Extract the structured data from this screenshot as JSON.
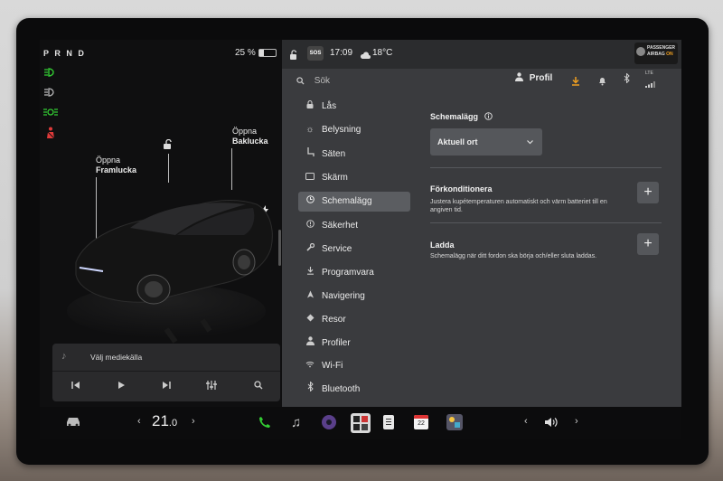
{
  "left_panel": {
    "gear": "P R N D",
    "battery_pct": "25 %",
    "frunk_label_1": "Öppna",
    "frunk_label_2": "Framlucka",
    "trunk_label_1": "Öppna",
    "trunk_label_2": "Baklucka",
    "media_source": "Välj mediekälla"
  },
  "top_bar": {
    "sos": "SOS",
    "time": "17:09",
    "temperature": "18°C",
    "passenger_airbag_1": "PASSENGER",
    "passenger_airbag_2": "AIRBAG",
    "passenger_airbag_state": "ON"
  },
  "search": {
    "placeholder": "Sök"
  },
  "header": {
    "profile": "Profil",
    "lte": "LTE"
  },
  "menu": {
    "items": [
      {
        "label": "Lås",
        "icon": "lock-icon"
      },
      {
        "label": "Belysning",
        "icon": "sun-icon"
      },
      {
        "label": "Säten",
        "icon": "seat-icon"
      },
      {
        "label": "Skärm",
        "icon": "display-icon"
      },
      {
        "label": "Schemalägg",
        "icon": "clock-icon"
      },
      {
        "label": "Säkerhet",
        "icon": "info-icon"
      },
      {
        "label": "Service",
        "icon": "wrench-icon"
      },
      {
        "label": "Programvara",
        "icon": "download-icon"
      },
      {
        "label": "Navigering",
        "icon": "navigation-icon"
      },
      {
        "label": "Resor",
        "icon": "trips-icon"
      },
      {
        "label": "Profiler",
        "icon": "person-icon"
      },
      {
        "label": "Wi-Fi",
        "icon": "wifi-icon"
      },
      {
        "label": "Bluetooth",
        "icon": "bluetooth-icon"
      }
    ],
    "selected": "Schemalägg"
  },
  "content": {
    "title": "Schemalägg",
    "dropdown": "Aktuell ort",
    "precondition_title": "Förkonditionera",
    "precondition_desc_1": "Justera kupétemperaturen automatiskt och värm batteriet till en",
    "precondition_desc_2": "angiven tid.",
    "charge_title": "Ladda",
    "charge_desc": "Schemalägg när ditt fordon ska börja och/eller sluta laddas."
  },
  "bottom_bar": {
    "temperature_int": "21",
    "temperature_dec": ".0",
    "calendar_day": "22"
  },
  "colors": {
    "accent_green": "#33cc33",
    "highbeam_blue": "#4a7cd6",
    "airbag_on": "#f0a020",
    "selected_menu": "#5b5d61"
  }
}
